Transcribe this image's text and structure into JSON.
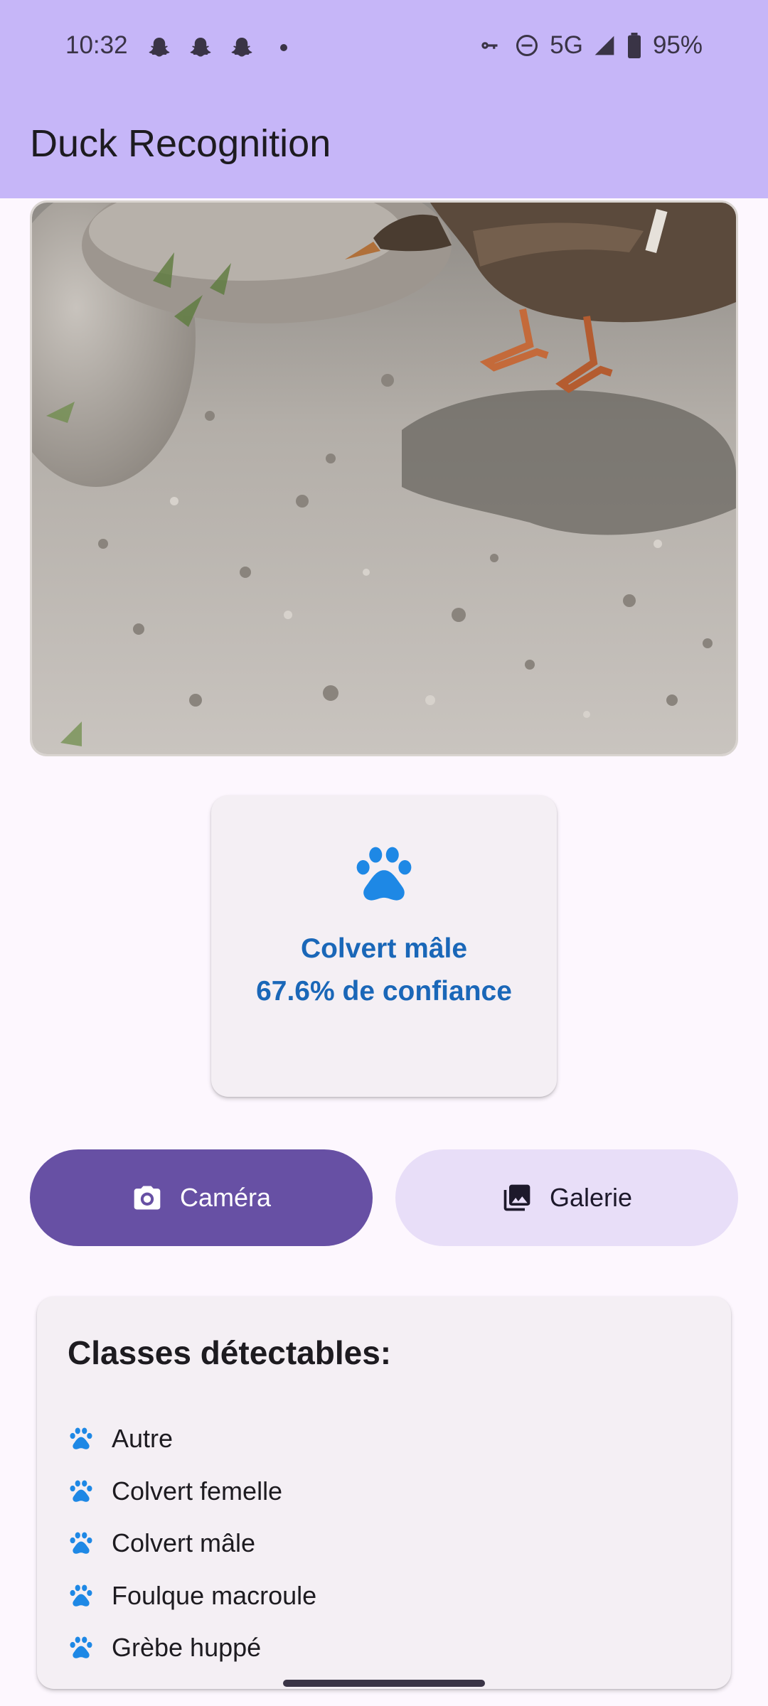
{
  "status_bar": {
    "time": "10:32",
    "network": "5G",
    "battery": "95%",
    "icons": [
      "snapchat-icon",
      "snapchat-icon",
      "snapchat-icon",
      "notification-dot",
      "vpn-key-icon",
      "do-not-disturb-icon",
      "signal-icon",
      "battery-icon"
    ]
  },
  "app_bar": {
    "title": "Duck Recognition"
  },
  "photo": {
    "description_icon": "duck-photo"
  },
  "result": {
    "icon": "paw-icon",
    "label": "Colvert mâle",
    "confidence_text": "67.6% de confiance",
    "color": "#1a67b8"
  },
  "buttons": {
    "camera": {
      "label": "Caméra",
      "icon": "camera-icon",
      "color": "#6750a4"
    },
    "gallery": {
      "label": "Galerie",
      "icon": "photo-library-icon",
      "color": "#e8def8"
    }
  },
  "classes": {
    "title": "Classes détectables:",
    "items": [
      "Autre",
      "Colvert femelle",
      "Colvert mâle",
      "Foulque macroule",
      "Grèbe huppé"
    ],
    "icon": "paw-icon",
    "icon_color": "#1e88e5"
  },
  "colors": {
    "app_bar": "#c6b6f8",
    "background": "#fdf7fe"
  }
}
